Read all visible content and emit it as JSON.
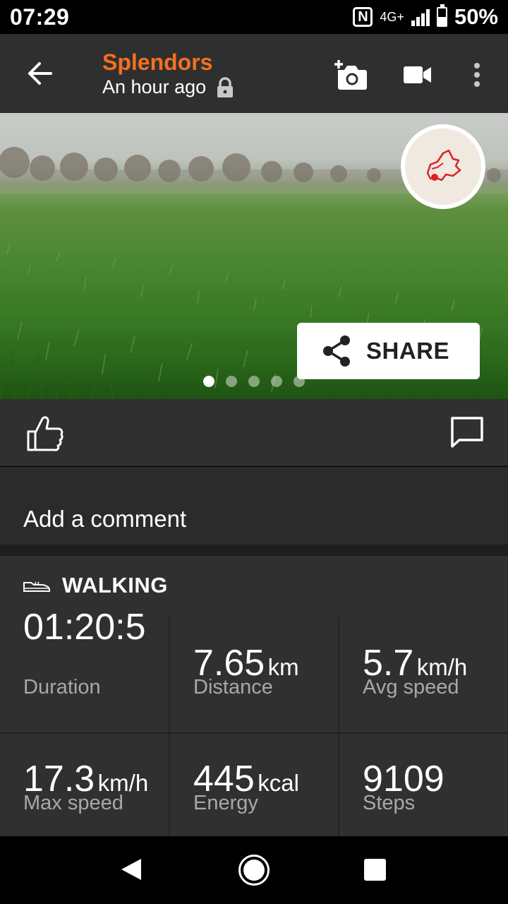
{
  "status_bar": {
    "time": "07:29",
    "nfc_label": "N",
    "network": "4G+",
    "battery_text": "50%",
    "battery_level": 0.5
  },
  "app_bar": {
    "title": "Splendors",
    "subtitle": "An hour ago",
    "icons": [
      "back-arrow-icon",
      "add-photo-icon",
      "video-camera-icon",
      "more-vert-icon",
      "lock-icon"
    ],
    "title_color": "#f3701f"
  },
  "photo": {
    "share_label": "SHARE",
    "page_count": 5,
    "active_page": 1,
    "badge_icon": "route-map-icon"
  },
  "actions": {
    "icons": [
      "thumb-up-icon",
      "comment-icon"
    ]
  },
  "comment": {
    "placeholder": "Add a comment"
  },
  "activity": {
    "icon": "shoe-icon",
    "label": "WALKING"
  },
  "stats": [
    {
      "value": "01:20:5",
      "unit": "",
      "label": "Duration"
    },
    {
      "value": "7.65",
      "unit": "km",
      "label": "Distance"
    },
    {
      "value": "5.7",
      "unit": "km/h",
      "label": "Avg speed"
    },
    {
      "value": "17.3",
      "unit": "km/h",
      "label": "Max speed"
    },
    {
      "value": "445",
      "unit": "kcal",
      "label": "Energy"
    },
    {
      "value": "9109",
      "unit": "",
      "label": "Steps"
    }
  ],
  "nav_bar": {
    "icons": [
      "nav-back-icon",
      "nav-home-icon",
      "nav-recents-icon"
    ]
  }
}
